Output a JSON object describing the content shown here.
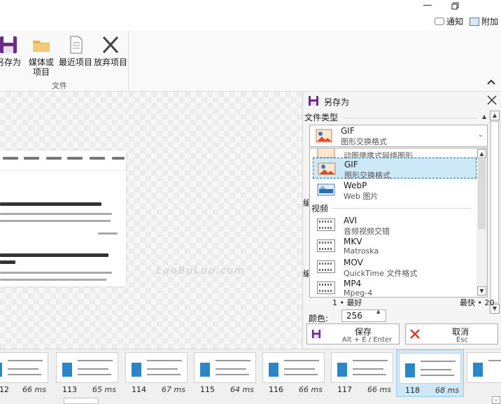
{
  "notify": {
    "notifications": "通知",
    "attachments": "附加"
  },
  "ribbon": {
    "save_as": "另存为",
    "media_or_project": [
      "媒体或",
      "项目"
    ],
    "recent_projects": "最近项目",
    "discard_project": "放弃项目",
    "group_label": "文件"
  },
  "canvas": {
    "watermark": "LaoBuLuo.com"
  },
  "panel": {
    "title": "另存为",
    "file_type_label": "文件类型",
    "selected_type": {
      "name": "GIF",
      "desc": "图形交换格式"
    },
    "list": [
      {
        "name": "",
        "desc": "动图便携式网络图形",
        "icon": "apng-icon"
      },
      {
        "name": "GIF",
        "desc": "图形交换格式",
        "icon": "gif-icon"
      },
      {
        "name": "WebP",
        "desc": "Web 图片",
        "icon": "webp-icon"
      },
      {
        "group": "视频"
      },
      {
        "name": "AVI",
        "desc": "音频视频交错",
        "icon": "film-icon"
      },
      {
        "name": "MKV",
        "desc": "Matroska",
        "icon": "film-icon"
      },
      {
        "name": "MOV",
        "desc": "QuickTime 文件格式",
        "icon": "film-icon"
      },
      {
        "name": "MP4",
        "desc": "Mpeg-4",
        "icon": "film-icon"
      }
    ],
    "side_label_1": "编",
    "side_label_2": "编",
    "quality_best": "1 • 最好",
    "quality_fast": "最快 • 20",
    "colors_label": "颜色:",
    "colors_value": "256",
    "save_button": {
      "label": "保存",
      "shortcut": "Alt + E / Enter"
    },
    "cancel_button": {
      "label": "取消",
      "shortcut": "Esc"
    }
  },
  "frames": [
    {
      "number": "12",
      "duration": "66 ms"
    },
    {
      "number": "113",
      "duration": "65 ms"
    },
    {
      "number": "114",
      "duration": "67 ms"
    },
    {
      "number": "115",
      "duration": "64 ms"
    },
    {
      "number": "116",
      "duration": "66 ms"
    },
    {
      "number": "117",
      "duration": "66 ms"
    },
    {
      "number": "118",
      "duration": "68 ms",
      "selected": true
    }
  ],
  "colors": {
    "accent": "#1b6fb5",
    "save_icon": "#6b2d86",
    "cancel_icon": "#d43b2a",
    "selection": "#cde8f6"
  }
}
